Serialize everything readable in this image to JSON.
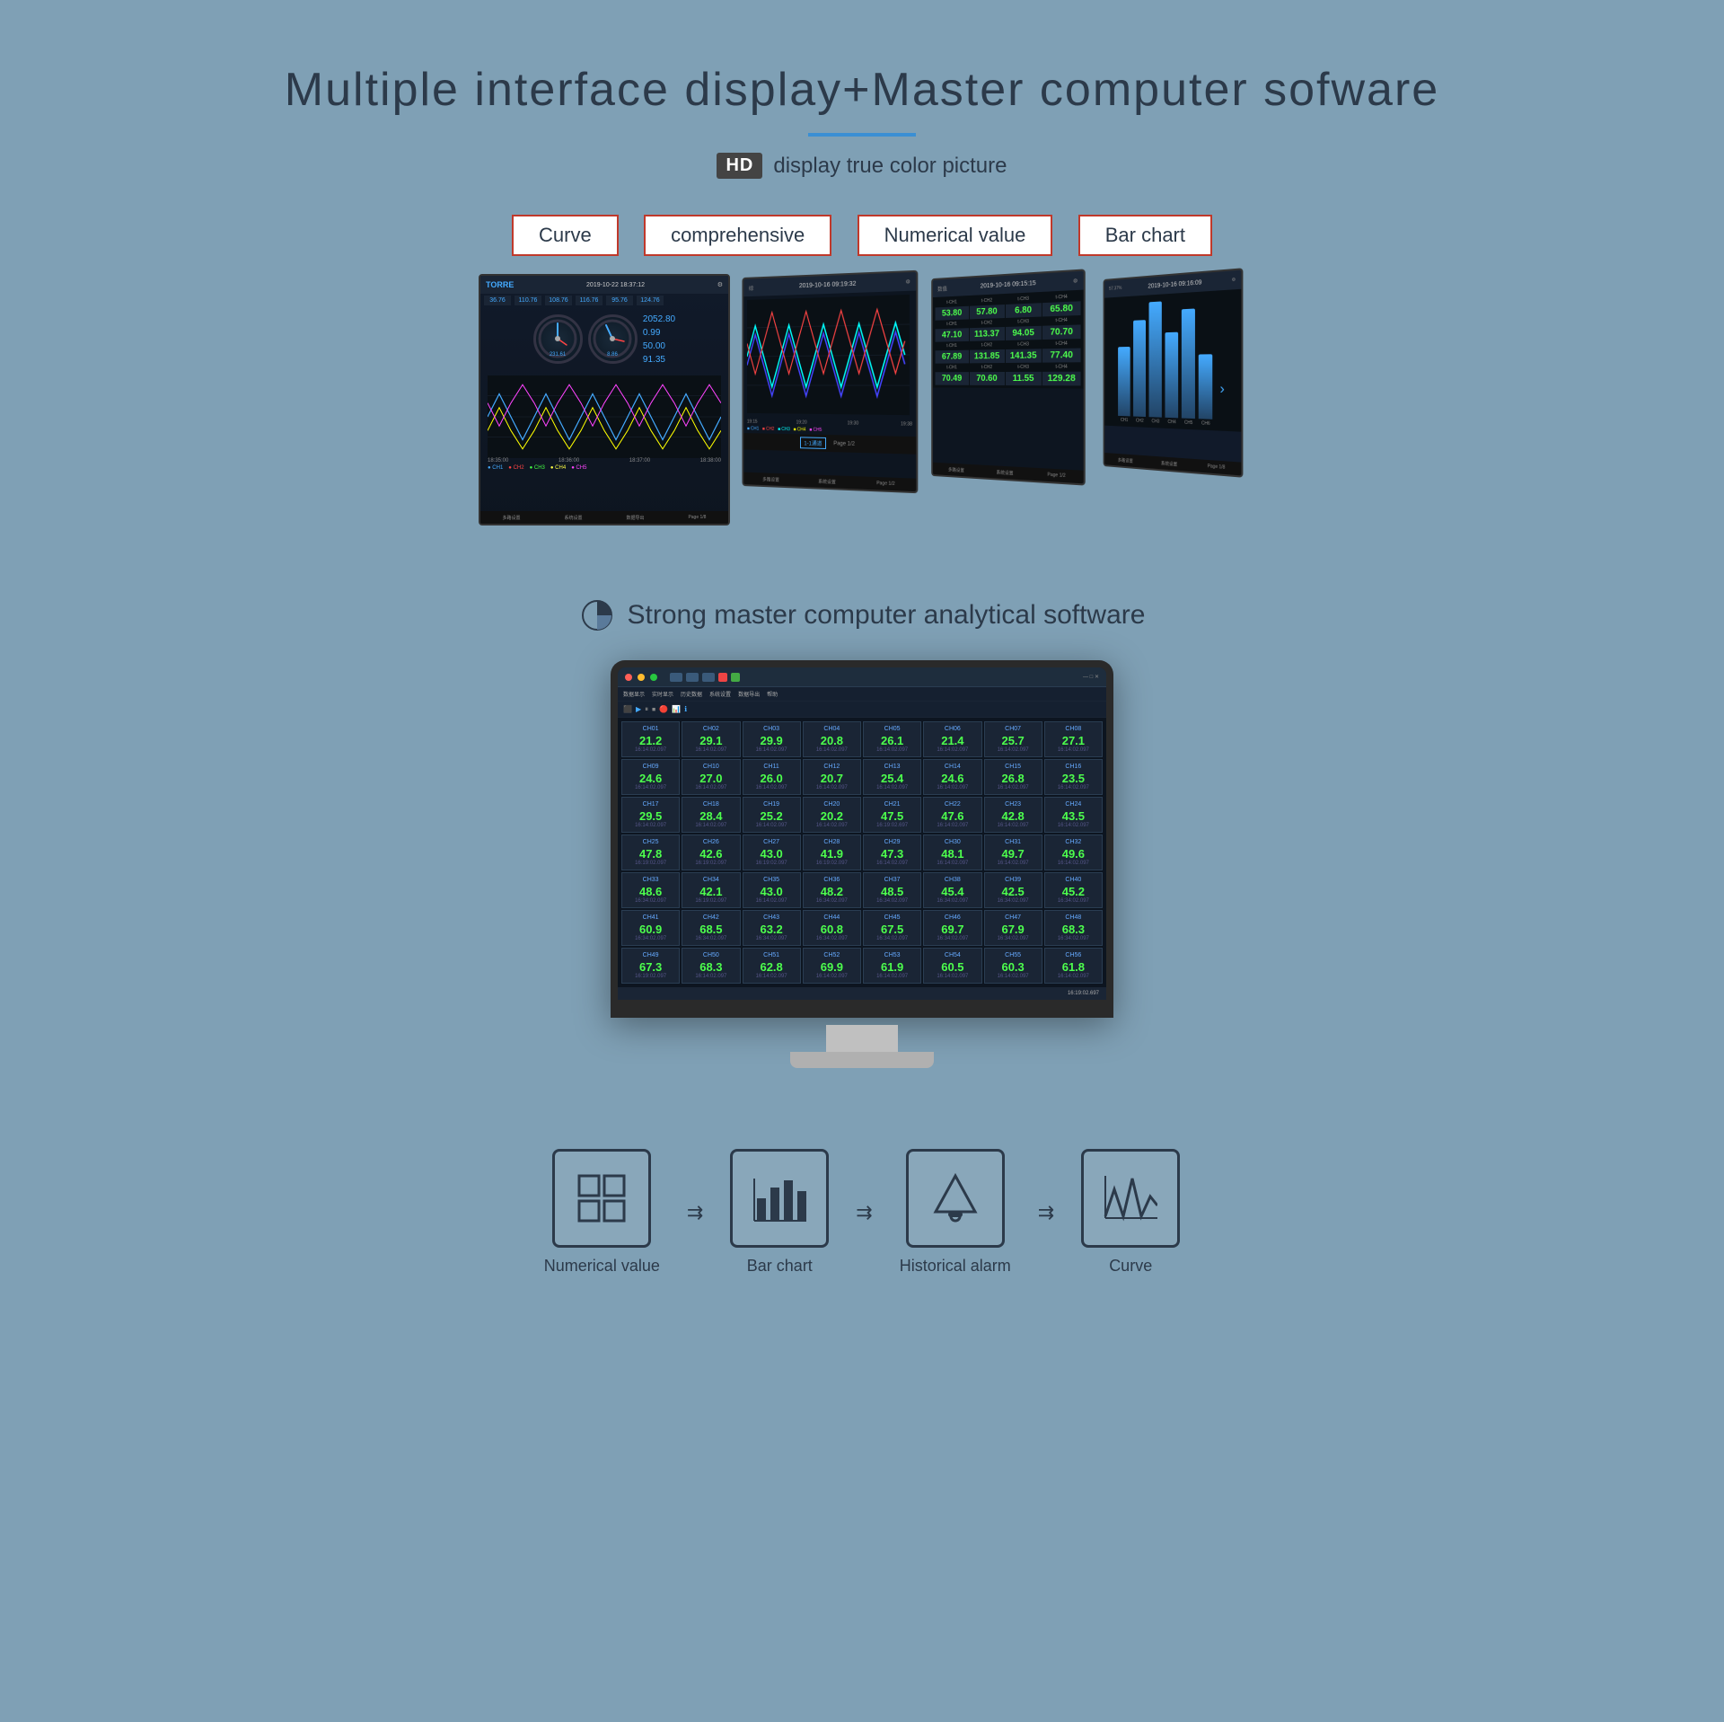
{
  "page": {
    "background": "#7fa0b5",
    "main_title": "Multiple interface display+Master computer sofware",
    "blue_underline": true,
    "hd_badge": "HD",
    "hd_desc": "display true color picture"
  },
  "top_labels": [
    {
      "id": "curve-label",
      "text": "Curve"
    },
    {
      "id": "comprehensive-label",
      "text": "comprehensive"
    },
    {
      "id": "numerical-label",
      "text": "Numerical value"
    },
    {
      "id": "barchart-label",
      "text": "Bar chart"
    }
  ],
  "screens": [
    {
      "id": "screen-curve",
      "type": "curve",
      "logo": "TORRE",
      "datetime": "2019-10-22  18:37:12",
      "numbers": [
        "36.76",
        "110.76",
        "108.76",
        "116.76",
        "95.76",
        "124.76"
      ],
      "values": [
        "2052.80",
        "0.99",
        "50.00",
        "91.35"
      ],
      "waveform": "sine"
    },
    {
      "id": "screen-comprehensive",
      "type": "comprehensive",
      "datetime": "2019-10-16  09:19:32",
      "waveform": "multi-sine"
    },
    {
      "id": "screen-numerical",
      "type": "numerical",
      "datetime": "2019-10-16  09:15:15",
      "values": [
        [
          "53.80",
          "57.80",
          "6.80",
          "65.80"
        ],
        [
          "47.10",
          "113.37",
          "94.05",
          "70.70"
        ],
        [
          "67.89",
          "131.85",
          "141.35",
          "77.40"
        ],
        [
          "70.49",
          "70.60",
          "11.55",
          "129.28"
        ]
      ]
    },
    {
      "id": "screen-barchart",
      "type": "barchart",
      "datetime": "2019-10-16  09:16:09",
      "bars": [
        60,
        80,
        100,
        70,
        90,
        50
      ]
    }
  ],
  "section2": {
    "title": "Strong master computer analytical software",
    "pie_icon": true
  },
  "data_grid": {
    "rows": [
      [
        {
          "label": "CH01",
          "value": "21.2",
          "time": "16:14:02.097"
        },
        {
          "label": "CH02",
          "value": "29.1",
          "time": "16:14:02.097"
        },
        {
          "label": "CH03",
          "value": "29.9",
          "time": "16:14:02.097"
        },
        {
          "label": "CH04",
          "value": "20.8",
          "time": "16:14:02.097"
        },
        {
          "label": "CH05",
          "value": "26.1",
          "time": "16:14:02.097"
        },
        {
          "label": "CH06",
          "value": "21.4",
          "time": "16:14:02.097"
        },
        {
          "label": "CH07",
          "value": "25.7",
          "time": "16:14:02.097"
        },
        {
          "label": "CH08",
          "value": "27.1",
          "time": "16:14:02.097"
        }
      ],
      [
        {
          "label": "CH09",
          "value": "24.6",
          "time": "16:14:02.097"
        },
        {
          "label": "CH10",
          "value": "27.0",
          "time": "16:14:02.097"
        },
        {
          "label": "CH11",
          "value": "26.0",
          "time": "16:14:02.097"
        },
        {
          "label": "CH12",
          "value": "20.7",
          "time": "16:14:02.097"
        },
        {
          "label": "CH13",
          "value": "25.4",
          "time": "16:14:02.097"
        },
        {
          "label": "CH14",
          "value": "24.6",
          "time": "16:14:02.097"
        },
        {
          "label": "CH15",
          "value": "26.8",
          "time": "16:14:02.097"
        },
        {
          "label": "CH16",
          "value": "23.5",
          "time": "16:14:02.097"
        }
      ],
      [
        {
          "label": "CH17",
          "value": "29.5",
          "time": "16:14:02.097"
        },
        {
          "label": "CH18",
          "value": "28.4",
          "time": "16:14:02.097"
        },
        {
          "label": "CH19",
          "value": "25.2",
          "time": "16:14:02.097"
        },
        {
          "label": "CH20",
          "value": "20.2",
          "time": "16:14:02.097"
        },
        {
          "label": "CH21",
          "value": "47.5",
          "time": "16:19:02.697"
        },
        {
          "label": "CH22",
          "value": "47.6",
          "time": "16:14:02.097"
        },
        {
          "label": "CH23",
          "value": "42.8",
          "time": "16:14:02.097"
        },
        {
          "label": "CH24",
          "value": "43.5",
          "time": "16:14:02.097"
        }
      ],
      [
        {
          "label": "CH25",
          "value": "47.8",
          "time": "16:19:02.097"
        },
        {
          "label": "CH26",
          "value": "42.6",
          "time": "16:19:02.097"
        },
        {
          "label": "CH27",
          "value": "43.0",
          "time": "16:19:02.097"
        },
        {
          "label": "CH28",
          "value": "41.9",
          "time": "16:19:02.097"
        },
        {
          "label": "CH29",
          "value": "47.3",
          "time": "16:14:02.097"
        },
        {
          "label": "CH30",
          "value": "48.1",
          "time": "16:14:02.097"
        },
        {
          "label": "CH31",
          "value": "49.7",
          "time": "16:14:02.097"
        },
        {
          "label": "CH32",
          "value": "49.6",
          "time": "16:14:02.097"
        }
      ],
      [
        {
          "label": "CH33",
          "value": "48.6",
          "time": "16:34:02.097"
        },
        {
          "label": "CH34",
          "value": "42.1",
          "time": "16:19:02.097"
        },
        {
          "label": "CH35",
          "value": "43.0",
          "time": "16:14:02.097"
        },
        {
          "label": "CH36",
          "value": "48.2",
          "time": "16:34:02.097"
        },
        {
          "label": "CH37",
          "value": "48.5",
          "time": "16:34:02.097"
        },
        {
          "label": "CH38",
          "value": "45.4",
          "time": "16:34:02.097"
        },
        {
          "label": "CH39",
          "value": "42.5",
          "time": "16:34:02.097"
        },
        {
          "label": "CH40",
          "value": "45.2",
          "time": "16:34:02.097"
        }
      ],
      [
        {
          "label": "CH41",
          "value": "60.9",
          "time": "16:34:02.097"
        },
        {
          "label": "CH42",
          "value": "68.5",
          "time": "16:34:02.097"
        },
        {
          "label": "CH43",
          "value": "63.2",
          "time": "16:34:02.097"
        },
        {
          "label": "CH44",
          "value": "60.8",
          "time": "16:34:02.097"
        },
        {
          "label": "CH45",
          "value": "67.5",
          "time": "16:34:02.097"
        },
        {
          "label": "CH46",
          "value": "69.7",
          "time": "16:34:02.097"
        },
        {
          "label": "CH47",
          "value": "67.9",
          "time": "16:34:02.097"
        },
        {
          "label": "CH48",
          "value": "68.3",
          "time": "16:34:02.097"
        }
      ],
      [
        {
          "label": "CH49",
          "value": "67.3",
          "time": "16:19:02.097"
        },
        {
          "label": "CH50",
          "value": "68.3",
          "time": "16:14:02.097"
        },
        {
          "label": "CH51",
          "value": "62.8",
          "time": "16:14:02.097"
        },
        {
          "label": "CH52",
          "value": "69.9",
          "time": "16:14:02.097"
        },
        {
          "label": "CH53",
          "value": "61.9",
          "time": "16:14:02.097"
        },
        {
          "label": "CH54",
          "value": "60.5",
          "time": "16:14:02.097"
        },
        {
          "label": "CH55",
          "value": "60.3",
          "time": "16:14:02.097"
        },
        {
          "label": "CH56",
          "value": "61.8",
          "time": "16:14:02.097"
        }
      ]
    ]
  },
  "bottom_icons": [
    {
      "id": "numerical-value-icon",
      "label": "Numerical value",
      "icon": "grid"
    },
    {
      "id": "arrow1",
      "type": "arrow"
    },
    {
      "id": "bar-chart-icon",
      "label": "Bar chart",
      "icon": "bars"
    },
    {
      "id": "arrow2",
      "type": "arrow"
    },
    {
      "id": "historical-alarm-icon",
      "label": "Historical alarm",
      "icon": "bell"
    },
    {
      "id": "arrow3",
      "type": "arrow"
    },
    {
      "id": "curve-icon",
      "label": "Curve",
      "icon": "wave"
    }
  ],
  "nav_items": [
    "多路设置",
    "系统设置",
    "数据导出",
    "Page 1/8"
  ]
}
